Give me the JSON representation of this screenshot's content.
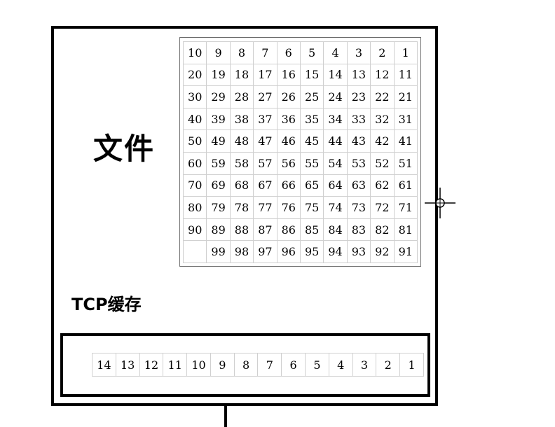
{
  "file_label": "文件",
  "tcp_label": "TCP缓存",
  "file_grid": {
    "rows": [
      [
        "10",
        "9",
        "8",
        "7",
        "6",
        "5",
        "4",
        "3",
        "2",
        "1"
      ],
      [
        "20",
        "19",
        "18",
        "17",
        "16",
        "15",
        "14",
        "13",
        "12",
        "11"
      ],
      [
        "30",
        "29",
        "28",
        "27",
        "26",
        "25",
        "24",
        "23",
        "22",
        "21"
      ],
      [
        "40",
        "39",
        "38",
        "37",
        "36",
        "35",
        "34",
        "33",
        "32",
        "31"
      ],
      [
        "50",
        "49",
        "48",
        "47",
        "46",
        "45",
        "44",
        "43",
        "42",
        "41"
      ],
      [
        "60",
        "59",
        "58",
        "57",
        "56",
        "55",
        "54",
        "53",
        "52",
        "51"
      ],
      [
        "70",
        "69",
        "68",
        "67",
        "66",
        "65",
        "64",
        "63",
        "62",
        "61"
      ],
      [
        "80",
        "79",
        "78",
        "77",
        "76",
        "75",
        "74",
        "73",
        "72",
        "71"
      ],
      [
        "90",
        "89",
        "88",
        "87",
        "86",
        "85",
        "84",
        "83",
        "82",
        "81"
      ],
      [
        "",
        "99",
        "98",
        "97",
        "96",
        "95",
        "94",
        "93",
        "92",
        "91"
      ]
    ]
  },
  "tcp_buffer": {
    "cells": [
      "14",
      "13",
      "12",
      "11",
      "10",
      "9",
      "8",
      "7",
      "6",
      "5",
      "4",
      "3",
      "2",
      "1"
    ]
  },
  "colors": {
    "border": "#000000",
    "grid_line": "#d0d0d0",
    "grid_frame": "#6b6b6b"
  },
  "icons": {
    "cursor": "crosshair-cursor-icon"
  }
}
